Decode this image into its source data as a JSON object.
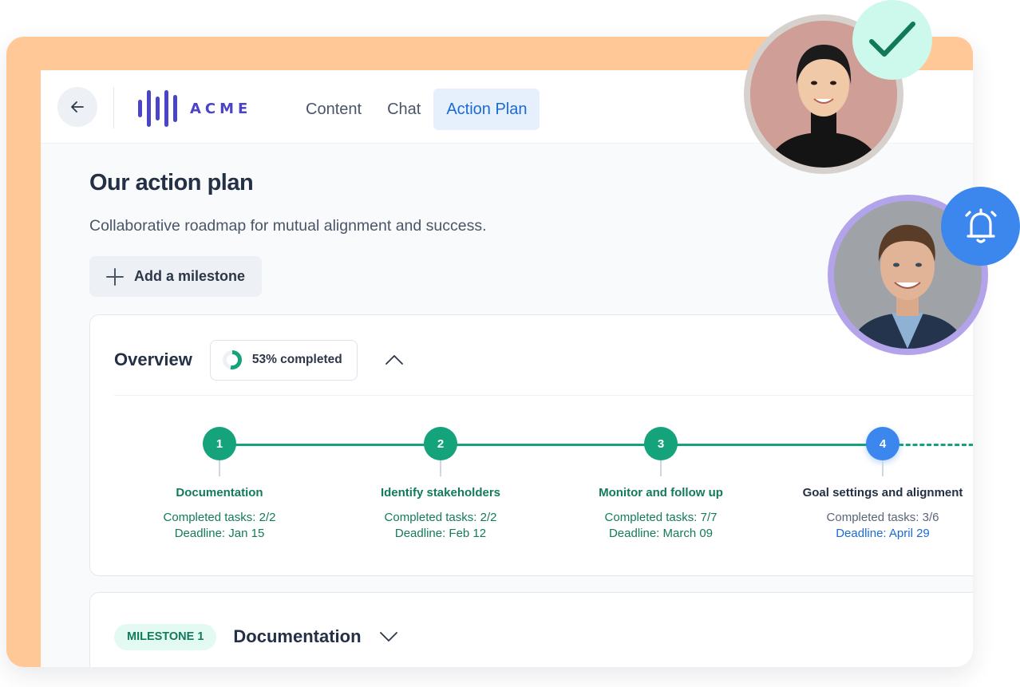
{
  "nav": {
    "back_label": "Back",
    "logo_text": "ACME",
    "tabs": [
      {
        "label": "Content",
        "active": false
      },
      {
        "label": "Chat",
        "active": false
      },
      {
        "label": "Action Plan",
        "active": true
      }
    ]
  },
  "page": {
    "title": "Our action plan",
    "subtitle": "Collaborative roadmap for mutual alignment and success.",
    "add_milestone_label": "Add a milestone"
  },
  "overview": {
    "title": "Overview",
    "progress_percent": 53,
    "progress_label": "53% completed",
    "collapse_icon": "chevron-up-icon",
    "steps": [
      {
        "number": "1",
        "name": "Documentation",
        "tasks": "Completed tasks: 2/2",
        "deadline": "Deadline: Jan 15",
        "status": "done"
      },
      {
        "number": "2",
        "name": "Identify stakeholders",
        "tasks": "Completed tasks: 2/2",
        "deadline": "Deadline: Feb 12",
        "status": "done"
      },
      {
        "number": "3",
        "name": "Monitor and follow up",
        "tasks": "Completed tasks: 7/7",
        "deadline": "Deadline: March 09",
        "status": "done"
      },
      {
        "number": "4",
        "name": "Goal settings and alignment",
        "tasks": "Completed tasks: 3/6",
        "deadline": "Deadline: April 29",
        "status": "current"
      }
    ]
  },
  "milestone": {
    "badge": "MILESTONE 1",
    "title": "Documentation",
    "toggle_icon": "chevron-down-icon"
  },
  "overlays": {
    "avatar_1_badge_icon": "checkmark-icon",
    "avatar_2_badge_icon": "alarm-bell-icon"
  },
  "colors": {
    "frame": "#ffc896",
    "brand": "#4b44c6",
    "accent_blue": "#1a6ad6",
    "done_green": "#14a37a",
    "current_blue": "#3b87ee",
    "check_badge": "#cdf8ec"
  }
}
